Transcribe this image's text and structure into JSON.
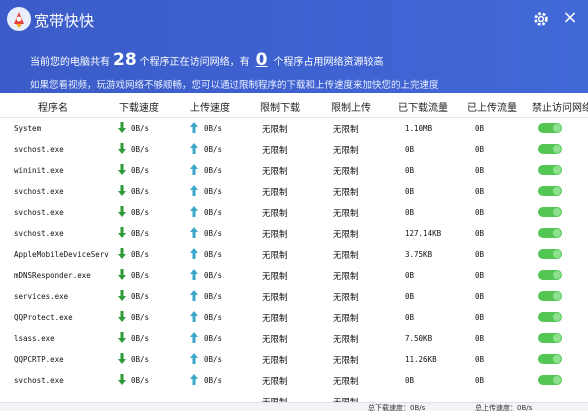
{
  "app": {
    "title": "宽带快快"
  },
  "summary": {
    "prefix": "当前您的电脑共有",
    "program_count": "28",
    "middle": "个程序正在访问网络，有",
    "heavy_count": "0",
    "suffix": "个程序占用网络资源较高",
    "hint": "如果您看视频，玩游戏网络不够顺畅，您可以通过限制程序的下载和上传速度来加快您的上完速度"
  },
  "columns": {
    "name": "程序名",
    "down_speed": "下载速度",
    "up_speed": "上传速度",
    "limit_down": "限制下载",
    "limit_up": "限制上传",
    "downloaded": "已下载流量",
    "uploaded": "已上传流量",
    "block": "禁止访问网络"
  },
  "rows": [
    {
      "name": "System",
      "down": "0B/s",
      "up": "0B/s",
      "limit_down": "无限制",
      "limit_up": "无限制",
      "downloaded": "1.10MB",
      "uploaded": "0B"
    },
    {
      "name": "svchost.exe",
      "down": "0B/s",
      "up": "0B/s",
      "limit_down": "无限制",
      "limit_up": "无限制",
      "downloaded": "0B",
      "uploaded": "0B"
    },
    {
      "name": "wininit.exe",
      "down": "0B/s",
      "up": "0B/s",
      "limit_down": "无限制",
      "limit_up": "无限制",
      "downloaded": "0B",
      "uploaded": "0B"
    },
    {
      "name": "svchost.exe",
      "down": "0B/s",
      "up": "0B/s",
      "limit_down": "无限制",
      "limit_up": "无限制",
      "downloaded": "0B",
      "uploaded": "0B"
    },
    {
      "name": "svchost.exe",
      "down": "0B/s",
      "up": "0B/s",
      "limit_down": "无限制",
      "limit_up": "无限制",
      "downloaded": "0B",
      "uploaded": "0B"
    },
    {
      "name": "svchost.exe",
      "down": "0B/s",
      "up": "0B/s",
      "limit_down": "无限制",
      "limit_up": "无限制",
      "downloaded": "127.14KB",
      "uploaded": "0B"
    },
    {
      "name": "AppleMobileDeviceServ",
      "down": "0B/s",
      "up": "0B/s",
      "limit_down": "无限制",
      "limit_up": "无限制",
      "downloaded": "3.75KB",
      "uploaded": "0B"
    },
    {
      "name": "mDNSResponder.exe",
      "down": "0B/s",
      "up": "0B/s",
      "limit_down": "无限制",
      "limit_up": "无限制",
      "downloaded": "0B",
      "uploaded": "0B"
    },
    {
      "name": "services.exe",
      "down": "0B/s",
      "up": "0B/s",
      "limit_down": "无限制",
      "limit_up": "无限制",
      "downloaded": "0B",
      "uploaded": "0B"
    },
    {
      "name": "QQProtect.exe",
      "down": "0B/s",
      "up": "0B/s",
      "limit_down": "无限制",
      "limit_up": "无限制",
      "downloaded": "0B",
      "uploaded": "0B"
    },
    {
      "name": "lsass.exe",
      "down": "0B/s",
      "up": "0B/s",
      "limit_down": "无限制",
      "limit_up": "无限制",
      "downloaded": "7.50KB",
      "uploaded": "0B"
    },
    {
      "name": "QQPCRTP.exe",
      "down": "0B/s",
      "up": "0B/s",
      "limit_down": "无限制",
      "limit_up": "无限制",
      "downloaded": "11.26KB",
      "uploaded": "0B"
    },
    {
      "name": "svchost.exe",
      "down": "0B/s",
      "up": "0B/s",
      "limit_down": "无限制",
      "limit_up": "无限制",
      "downloaded": "0B",
      "uploaded": "0B"
    },
    {
      "name": "",
      "down": "",
      "up": "",
      "limit_down": "无限制",
      "limit_up": "无限制",
      "downloaded": "",
      "uploaded": ""
    }
  ],
  "colors": {
    "header_bg": "#3f63d2",
    "down_arrow": "#2e9a3a",
    "up_arrow": "#3aa7c9",
    "toggle_on": "#53c653"
  },
  "footer": {
    "total_down": "总下载速度：0B/s",
    "total_up": "总上传速度：0B/s"
  }
}
